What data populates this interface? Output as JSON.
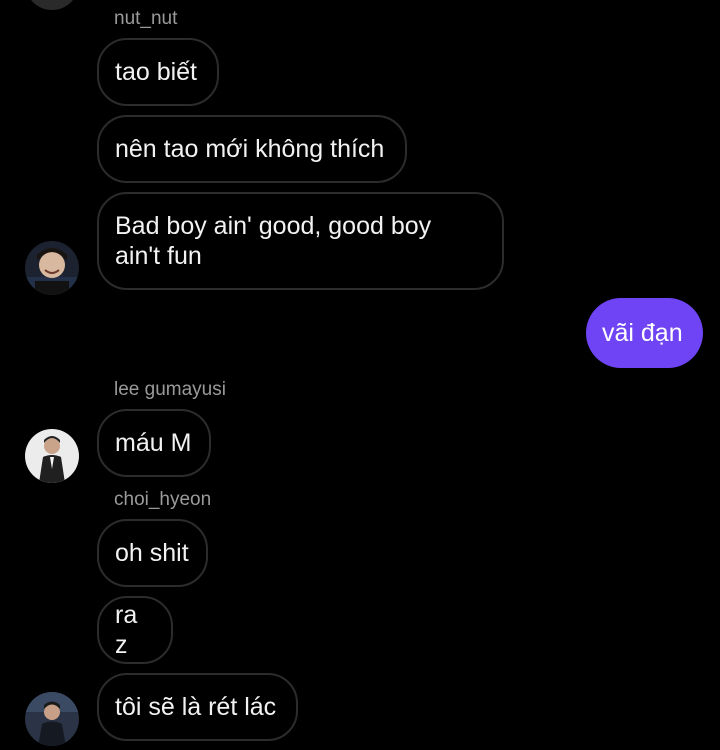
{
  "colors": {
    "background": "#000000",
    "incoming_border": "#2c2c2c",
    "outgoing_bubble": "#6e44f5",
    "sender_name": "#9a9a9a"
  },
  "messages": [
    {
      "sender": "nut_nut",
      "text": "tao biết"
    },
    {
      "text": "nên tao mới không thích"
    },
    {
      "text": "Bad boy ain' good, good boy ain't fun"
    },
    {
      "outgoing": true,
      "text": "vãi đạn"
    },
    {
      "sender": "lee gumayusi",
      "text": "máu M"
    },
    {
      "sender": "choi_hyeon",
      "text": "oh shit"
    },
    {
      "text": "ra z"
    },
    {
      "text": "tôi sẽ là rét lác"
    }
  ],
  "avatars": [
    {
      "name": "avatar-nut-nut",
      "icon": "person-photo-icon"
    },
    {
      "name": "avatar-lee-gumayusi",
      "icon": "person-photo-icon"
    },
    {
      "name": "avatar-choi-hyeon",
      "icon": "person-photo-icon"
    }
  ]
}
